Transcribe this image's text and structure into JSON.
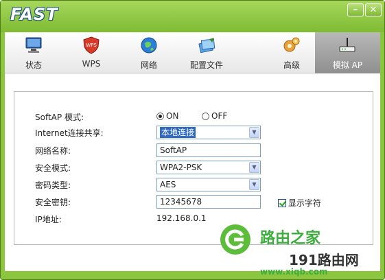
{
  "app": {
    "brand": "FAST",
    "minimize_glyph": "–",
    "close_glyph": "✕"
  },
  "tabs": [
    {
      "label": "状态",
      "icon": "monitor-icon"
    },
    {
      "label": "WPS",
      "icon": "shield-icon"
    },
    {
      "label": "网络",
      "icon": "globe-icon"
    },
    {
      "label": "配置文件",
      "icon": "profile-icon"
    },
    {
      "label": "高级",
      "icon": "gears-icon"
    },
    {
      "label": "模拟 AP",
      "icon": "router-icon",
      "active": true
    }
  ],
  "form": {
    "softap_mode": {
      "label": "SoftAP 模式:",
      "on_label": "ON",
      "off_label": "OFF",
      "selected": "ON"
    },
    "internet_share": {
      "label": "Internet连接共享:",
      "value": "本地连接"
    },
    "network_name": {
      "label": "网络名称:",
      "value": "SoftAP"
    },
    "security_mode": {
      "label": "安全模式:",
      "value": "WPA2-PSK"
    },
    "cipher_type": {
      "label": "密码类型:",
      "value": "AES"
    },
    "security_key": {
      "label": "安全密钥:",
      "value": "12345678",
      "show_chars_label": "显示字符",
      "show_chars_checked": true
    },
    "ip_address": {
      "label": "IP地址:",
      "value": "192.168.0.1"
    }
  },
  "watermark": {
    "cn": "路由之家",
    "mixed": "191路由网",
    "url": "www.xiqb.com"
  },
  "colors": {
    "brand_green": "#8cc63f",
    "selection_blue": "#316ac5",
    "watermark_green": "#3cae3c"
  }
}
